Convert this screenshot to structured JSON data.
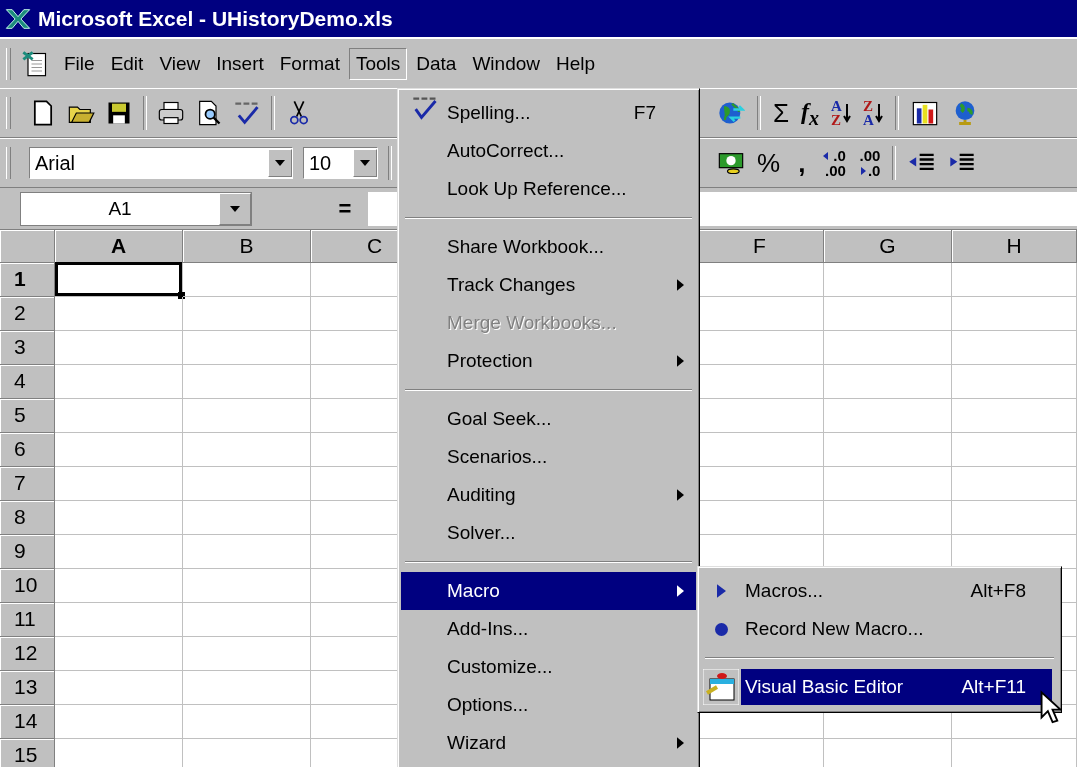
{
  "window": {
    "title": "Microsoft Excel - UHistoryDemo.xls"
  },
  "menu_bar": [
    {
      "label": "File",
      "selected": false
    },
    {
      "label": "Edit",
      "selected": false
    },
    {
      "label": "View",
      "selected": false
    },
    {
      "label": "Insert",
      "selected": false
    },
    {
      "label": "Format",
      "selected": false
    },
    {
      "label": "Tools",
      "selected": true
    },
    {
      "label": "Data",
      "selected": false
    },
    {
      "label": "Window",
      "selected": false
    },
    {
      "label": "Help",
      "selected": false
    }
  ],
  "standard_toolbar": {
    "sum": "Σ",
    "function": "f$_{x}$",
    "sort_ascending": [
      "A",
      "Z"
    ],
    "sort_descending": [
      "Z",
      "A"
    ]
  },
  "formatting_toolbar": {
    "font": "Arial",
    "size": "10",
    "percent": "%",
    "comma": ",",
    "increase_decimal": [
      ".0",
      ".00"
    ],
    "decrease_decimal": [
      ".00",
      ".0"
    ]
  },
  "formula_bar": {
    "name_box": "A1",
    "equals": "="
  },
  "grid": {
    "columns_left": [
      {
        "label": "A",
        "selected": true
      },
      {
        "label": "B",
        "selected": false
      },
      {
        "label": "C",
        "selected": false
      }
    ],
    "columns_right": [
      {
        "label": "F",
        "selected": false
      },
      {
        "label": "G",
        "selected": false
      },
      {
        "label": "H",
        "selected": false
      }
    ],
    "rows": [
      {
        "label": "1",
        "selected": true
      },
      {
        "label": "2",
        "selected": false
      },
      {
        "label": "3",
        "selected": false
      },
      {
        "label": "4",
        "selected": false
      },
      {
        "label": "5",
        "selected": false
      },
      {
        "label": "6",
        "selected": false
      },
      {
        "label": "7",
        "selected": false
      },
      {
        "label": "8",
        "selected": false
      },
      {
        "label": "9",
        "selected": false
      },
      {
        "label": "10",
        "selected": false
      },
      {
        "label": "11",
        "selected": false
      },
      {
        "label": "12",
        "selected": false
      },
      {
        "label": "13",
        "selected": false
      },
      {
        "label": "14",
        "selected": false
      },
      {
        "label": "15",
        "selected": false
      }
    ]
  },
  "tools_menu": {
    "groups": [
      [
        {
          "kind": "check",
          "label": "Spelling...",
          "shortcut": "F7",
          "submenu": false,
          "disabled": false,
          "selected": false
        },
        {
          "kind": "plain",
          "label": "AutoCorrect...",
          "submenu": false,
          "disabled": false,
          "selected": false
        },
        {
          "kind": "plain",
          "label": "Look Up Reference...",
          "submenu": false,
          "disabled": false,
          "selected": false
        }
      ],
      [
        {
          "kind": "plain",
          "label": "Share Workbook...",
          "submenu": false,
          "disabled": false,
          "selected": false
        },
        {
          "kind": "plain",
          "label": "Track Changes",
          "submenu": true,
          "disabled": false,
          "selected": false
        },
        {
          "kind": "plain",
          "label": "Merge Workbooks...",
          "submenu": false,
          "disabled": true,
          "selected": false
        },
        {
          "kind": "plain",
          "label": "Protection",
          "submenu": true,
          "disabled": false,
          "selected": false
        }
      ],
      [
        {
          "kind": "plain",
          "label": "Goal Seek...",
          "submenu": false,
          "disabled": false,
          "selected": false
        },
        {
          "kind": "plain",
          "label": "Scenarios...",
          "submenu": false,
          "disabled": false,
          "selected": false
        },
        {
          "kind": "plain",
          "label": "Auditing",
          "submenu": true,
          "disabled": false,
          "selected": false
        },
        {
          "kind": "plain",
          "label": "Solver...",
          "submenu": false,
          "disabled": false,
          "selected": false
        }
      ],
      [
        {
          "kind": "plain",
          "label": "Macro",
          "submenu": true,
          "disabled": false,
          "selected": true
        },
        {
          "kind": "plain",
          "label": "Add-Ins...",
          "submenu": false,
          "disabled": false,
          "selected": false
        },
        {
          "kind": "plain",
          "label": "Customize...",
          "submenu": false,
          "disabled": false,
          "selected": false
        },
        {
          "kind": "plain",
          "label": "Options...",
          "submenu": false,
          "disabled": false,
          "selected": false
        },
        {
          "kind": "plain",
          "label": "Wizard",
          "submenu": true,
          "disabled": false,
          "selected": false
        }
      ]
    ]
  },
  "macro_submenu": {
    "groups": [
      [
        {
          "kind": "triangle",
          "label": "Macros...",
          "shortcut": "Alt+F8",
          "selected": false
        },
        {
          "kind": "dot",
          "label": "Record New Macro...",
          "selected": false
        }
      ],
      [
        {
          "kind": "editor",
          "label": "Visual Basic Editor",
          "shortcut": "Alt+F11",
          "selected": true
        }
      ]
    ]
  }
}
